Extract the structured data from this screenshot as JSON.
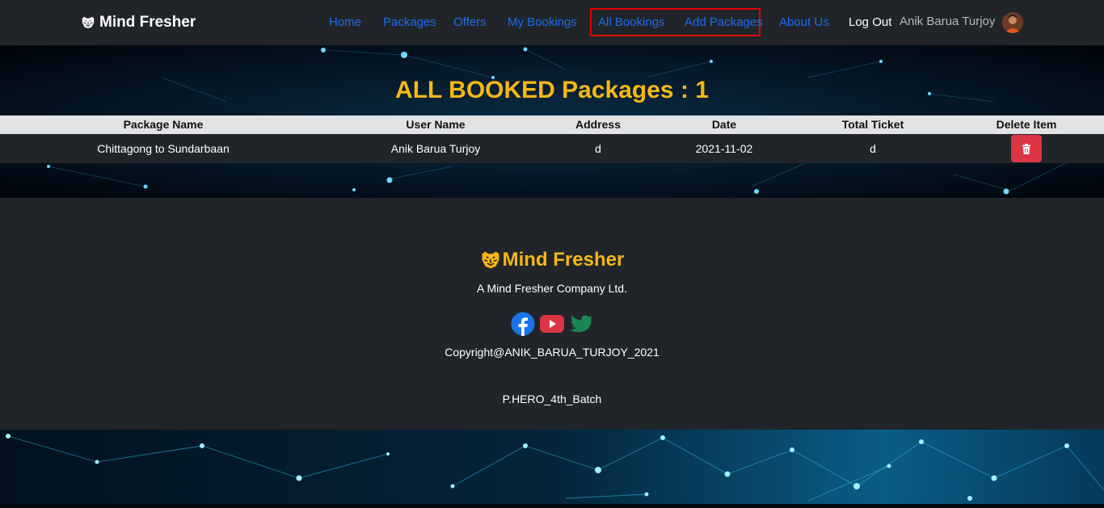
{
  "navbar": {
    "brand": "Mind Fresher",
    "links": {
      "home": "Home",
      "packages": "Packages",
      "offers": "Offers",
      "my_bookings": "My Bookings",
      "all_bookings": "All Bookings",
      "add_packages": "Add Packages",
      "about_us": "About Us",
      "log_out": "Log Out"
    },
    "user_name": "Anik Barua Turjoy"
  },
  "page": {
    "title": "ALL BOOKED Packages : 1"
  },
  "table": {
    "headers": [
      "Package Name",
      "User Name",
      "Address",
      "Date",
      "Total Ticket",
      "Delete Item"
    ],
    "rows": [
      [
        "Chittagong to Sundarbaan",
        "Anik Barua Turjoy",
        "d",
        "2021-11-02",
        "d"
      ]
    ]
  },
  "footer": {
    "brand": "Mind Fresher",
    "tagline": "A Mind Fresher Company Ltd.",
    "copyright": "Copyright@ANIK_BARUA_TURJOY_2021",
    "batch": "P.HERO_4th_Batch",
    "social_icons": [
      "facebook-icon",
      "youtube-icon",
      "twitter-icon"
    ]
  },
  "colors": {
    "accent": "#f6b716",
    "nav_link": "#1a6bf0",
    "dark_bg": "#212529",
    "danger": "#dc3545",
    "highlight_border": "#e00000"
  }
}
